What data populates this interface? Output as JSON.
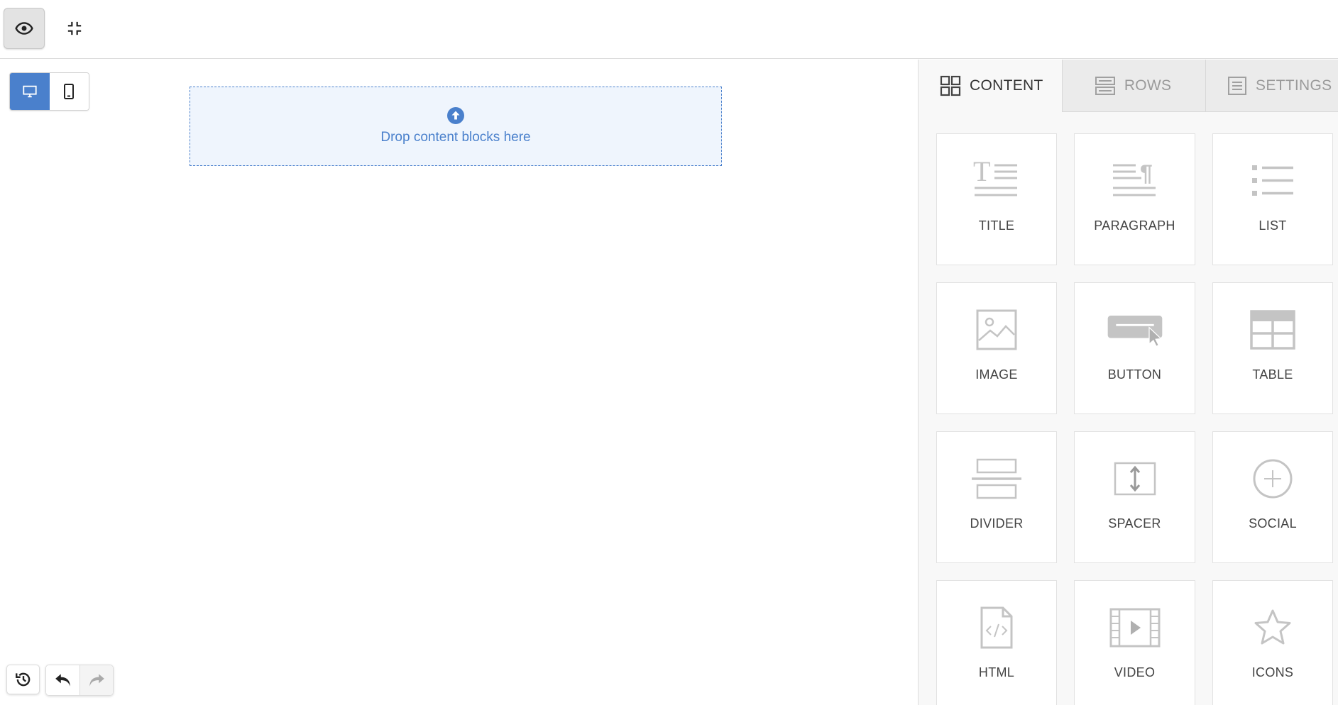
{
  "toolbar": {
    "preview_icon": "eye-icon",
    "collapse_icon": "compress-icon"
  },
  "canvas": {
    "device_toggle": {
      "desktop_icon": "desktop-icon",
      "mobile_icon": "mobile-icon",
      "active": "desktop"
    },
    "dropzone": {
      "icon": "upload-circle-icon",
      "label": "Drop content blocks here"
    },
    "history": {
      "history_icon": "history-icon",
      "undo_icon": "undo-icon",
      "redo_icon": "redo-icon"
    }
  },
  "sidebar": {
    "tabs": [
      {
        "label": "CONTENT",
        "icon": "grid-icon",
        "active": true
      },
      {
        "label": "ROWS",
        "icon": "rows-icon",
        "active": false
      },
      {
        "label": "SETTINGS",
        "icon": "settings-list-icon",
        "active": false
      }
    ],
    "blocks": [
      {
        "label": "TITLE",
        "icon": "title-icon"
      },
      {
        "label": "PARAGRAPH",
        "icon": "paragraph-icon"
      },
      {
        "label": "LIST",
        "icon": "list-icon"
      },
      {
        "label": "IMAGE",
        "icon": "image-icon"
      },
      {
        "label": "BUTTON",
        "icon": "button-icon"
      },
      {
        "label": "TABLE",
        "icon": "table-icon"
      },
      {
        "label": "DIVIDER",
        "icon": "divider-icon"
      },
      {
        "label": "SPACER",
        "icon": "spacer-icon"
      },
      {
        "label": "SOCIAL",
        "icon": "social-icon"
      },
      {
        "label": "HTML",
        "icon": "html-icon"
      },
      {
        "label": "VIDEO",
        "icon": "video-icon"
      },
      {
        "label": "ICONS",
        "icon": "star-icon"
      }
    ]
  },
  "colors": {
    "accent": "#4a80cc",
    "dropzone_bg": "#eff5fd",
    "icon_gray": "#c4c4c4"
  }
}
